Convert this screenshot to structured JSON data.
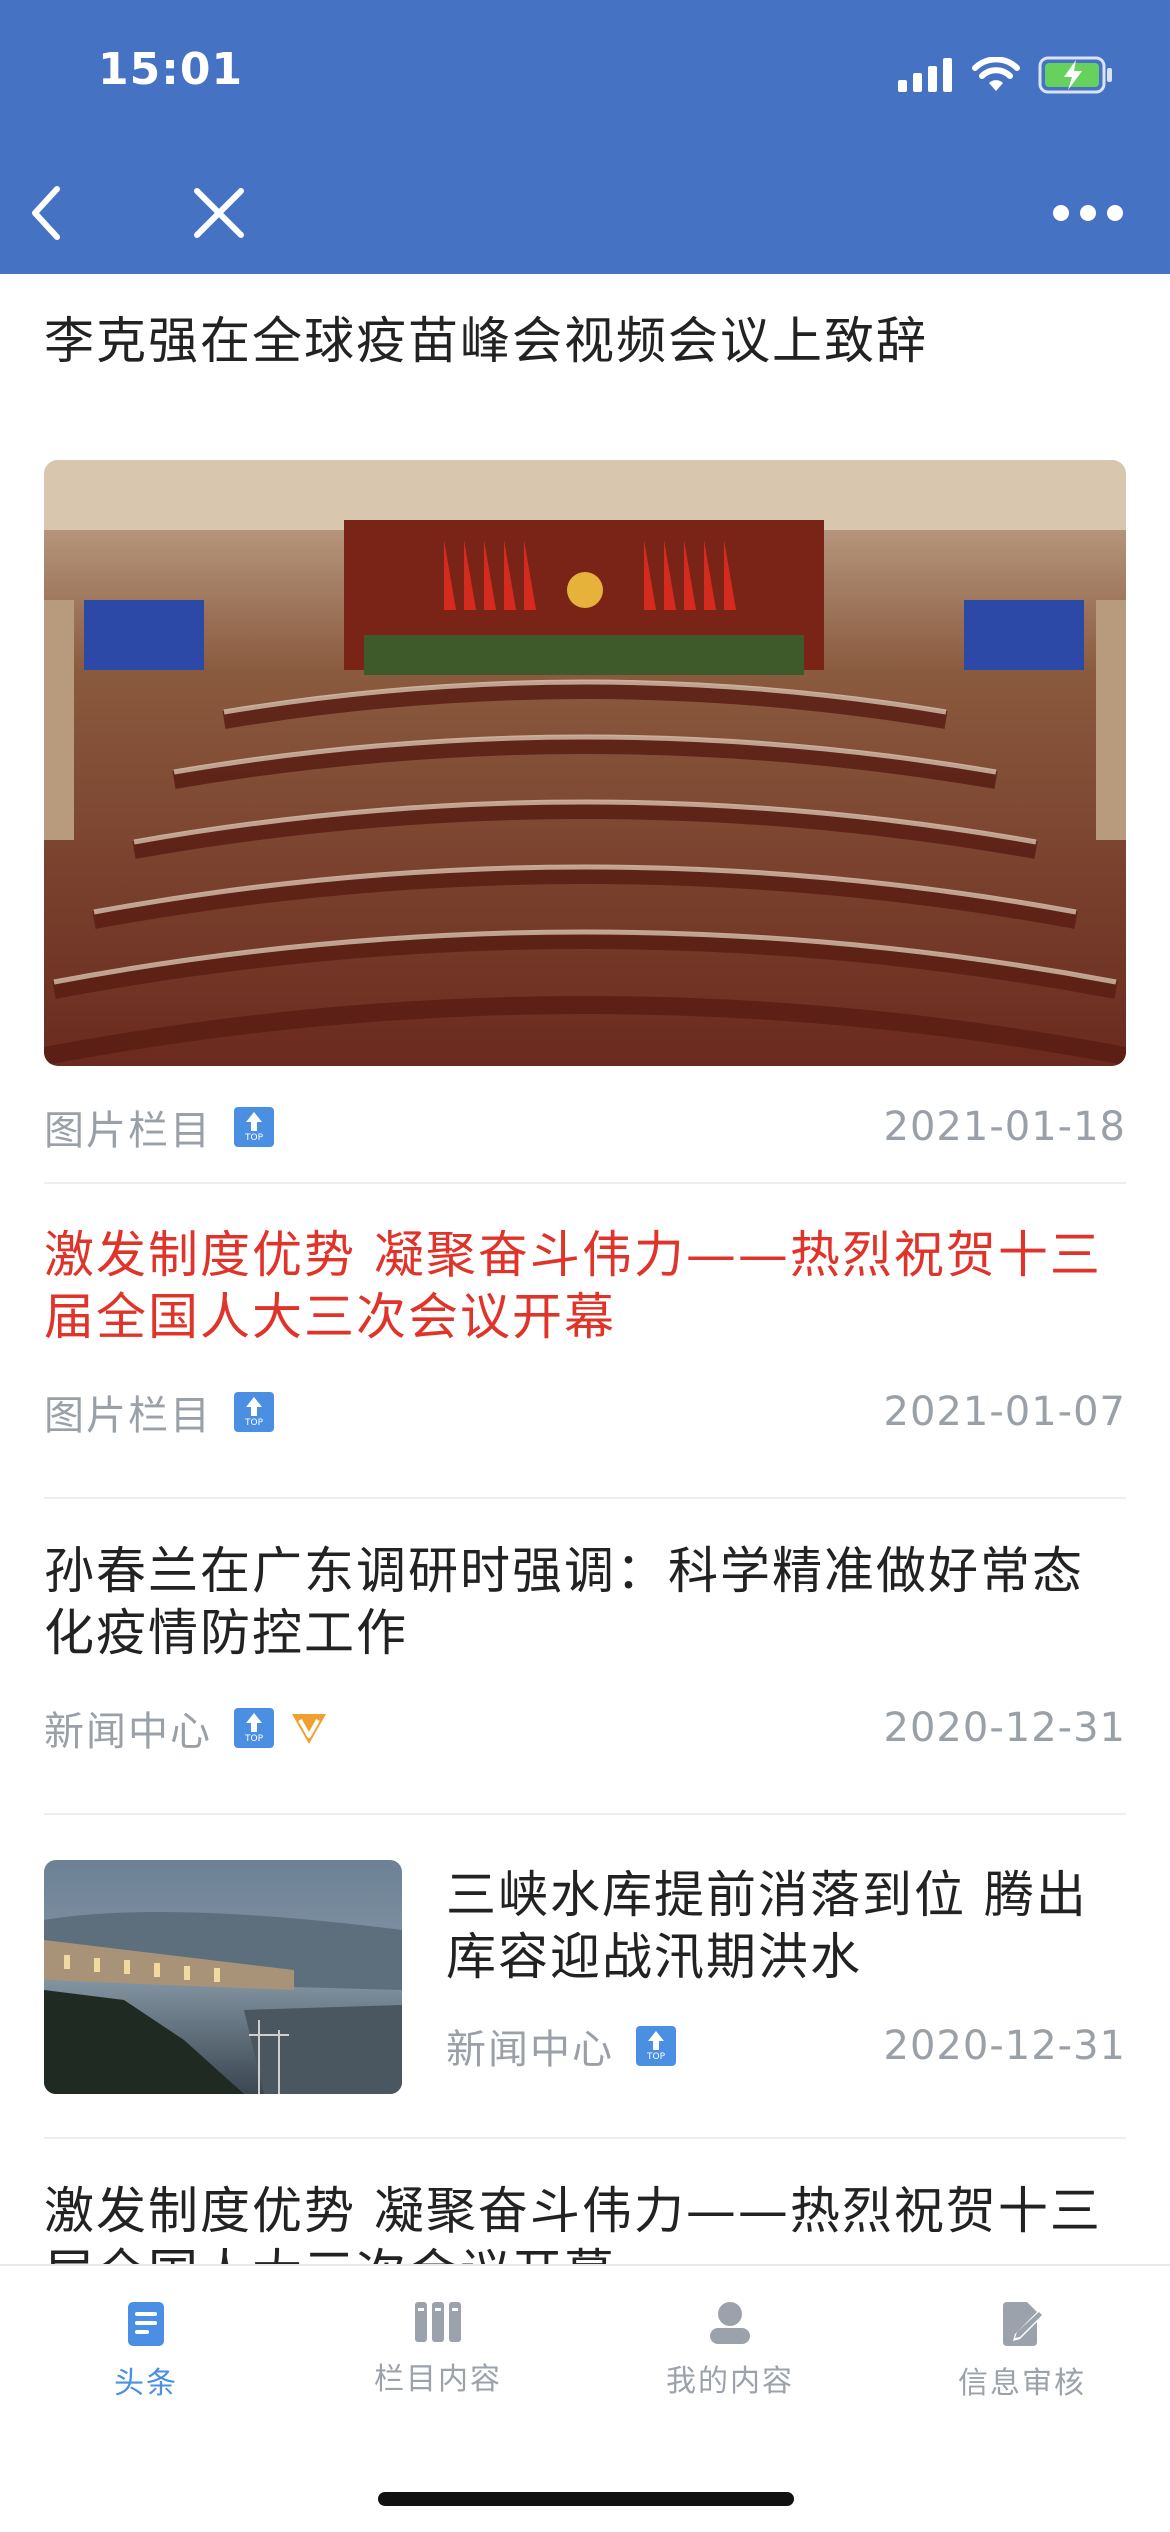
{
  "status_bar": {
    "time": "15:01"
  },
  "articles": [
    {
      "title": "李克强在全球疫苗峰会视频会议上致辞",
      "category": "图片栏目",
      "date": "2021-01-18",
      "badges": [
        "top"
      ]
    },
    {
      "title": "激发制度优势 凝聚奋斗伟力——热烈祝贺十三届全国人大三次会议开幕",
      "category": "图片栏目",
      "date": "2021-01-07",
      "badges": [
        "top"
      ],
      "highlight_color": "#e0342a"
    },
    {
      "title": "孙春兰在广东调研时强调：科学精准做好常态化疫情防控工作",
      "category": "新闻中心",
      "date": "2020-12-31",
      "badges": [
        "top",
        "v"
      ]
    },
    {
      "title": "三峡水库提前消落到位 腾出库容迎战汛期洪水",
      "category": "新闻中心",
      "date": "2020-12-31",
      "badges": [
        "top"
      ]
    },
    {
      "title": "激发制度优势 凝聚奋斗伟力——热烈祝贺十三届全国人大三次会议开幕"
    }
  ],
  "top_badge_text": "TOP",
  "tabs": [
    {
      "label": "头条",
      "icon": "document-icon",
      "active": true
    },
    {
      "label": "栏目内容",
      "icon": "columns-icon",
      "active": false
    },
    {
      "label": "我的内容",
      "icon": "user-icon",
      "active": false
    },
    {
      "label": "信息审核",
      "icon": "edit-document-icon",
      "active": false
    }
  ],
  "colors": {
    "header": "#4672c4",
    "accent": "#4a8fe3",
    "highlight": "#e0342a",
    "meta": "#9aa0a8"
  }
}
